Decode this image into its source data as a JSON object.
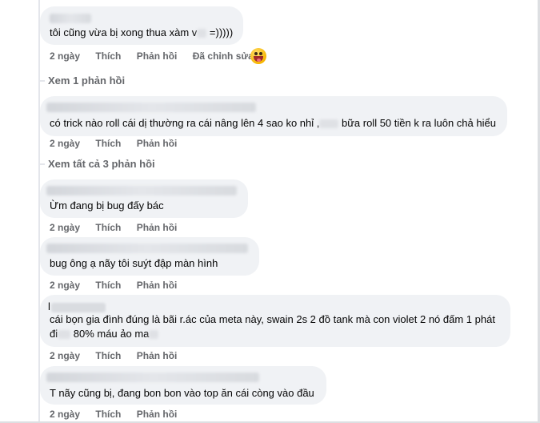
{
  "comments": [
    {
      "text_before": "tôi cũng vừa bị xong thua xàm v",
      "text_after": " =)))))",
      "actions": [
        "2 ngày",
        "Thích",
        "Phản hồi",
        "Đã chỉnh sửa"
      ],
      "reaction": "laughing-emoji"
    },
    {
      "text_before": "có trick nào roll cái dị thường ra cái nâng lên 4 sao ko nhỉ ,",
      "text_after": " bữa roll 50 tiền k ra luôn chả hiểu",
      "actions": [
        "2 ngày",
        "Thích",
        "Phản hồi"
      ]
    },
    {
      "text": "Ừm đang bị bug đấy bác",
      "actions": [
        "2 ngày",
        "Thích",
        "Phản hồi"
      ]
    },
    {
      "text": "bug ông ạ nãy tôi suýt đập màn hình",
      "actions": [
        "2 ngày",
        "Thích",
        "Phản hồi"
      ]
    },
    {
      "author_initial": "l",
      "line1": "cái bọn gia đình đúng là bãi r.ác của meta này, swain 2s 2 đồ tank mà con violet 2 nó đấm 1 phát",
      "line2_before": "đi",
      "line2_after": " 80% máu ảo ma",
      "actions": [
        "2 ngày",
        "Thích",
        "Phản hồi"
      ]
    },
    {
      "text": "T nãy cũng bị, đang bon bon vào top ăn cái còng vào đầu",
      "actions": [
        "2 ngày",
        "Thích",
        "Phản hồi"
      ]
    }
  ],
  "view_replies": [
    "Xem 1 phản hồi",
    "Xem tất cả 3 phản hồi"
  ],
  "colors": {
    "bubble": "#f0f2f5",
    "muted": "#65676b",
    "text": "#050505",
    "background": "#ffffff"
  }
}
